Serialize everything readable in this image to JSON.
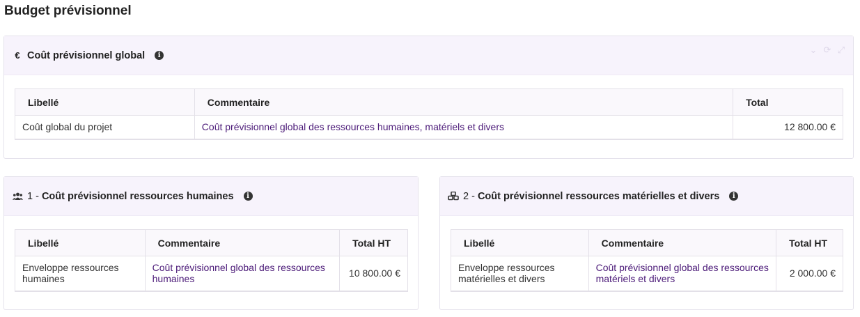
{
  "page": {
    "title": "Budget prévisionnel"
  },
  "global": {
    "icon": "euro-icon",
    "title": "Coût prévisionnel global",
    "columns": [
      "Libellé",
      "Commentaire",
      "Total"
    ],
    "row": {
      "libelle": "Coût global du projet",
      "commentaire": "Coût prévisionnel global des ressources humaines, matériels et divers",
      "total": "12 800.00 €"
    }
  },
  "rh": {
    "icon": "users-icon",
    "prefix": "1 - ",
    "title": "Coût prévisionnel ressources humaines",
    "columns": [
      "Libellé",
      "Commentaire",
      "Total HT"
    ],
    "row": {
      "libelle": "Enveloppe ressources humaines",
      "commentaire": "Coût prévisionnel global des ressources humaines",
      "total": "10 800.00 €"
    }
  },
  "materiel": {
    "icon": "cubes-icon",
    "prefix": "2 - ",
    "title": "Coût prévisionnel ressources matérielles et divers",
    "columns": [
      "Libellé",
      "Commentaire",
      "Total HT"
    ],
    "row": {
      "libelle": "Enveloppe ressources matérielles et divers",
      "commentaire": "Coût prévisionnel global des ressources matériels et divers",
      "total": "2 000.00 €"
    }
  },
  "colors": {
    "header_bg": "#f7f3fc",
    "link": "#4b1a78"
  }
}
